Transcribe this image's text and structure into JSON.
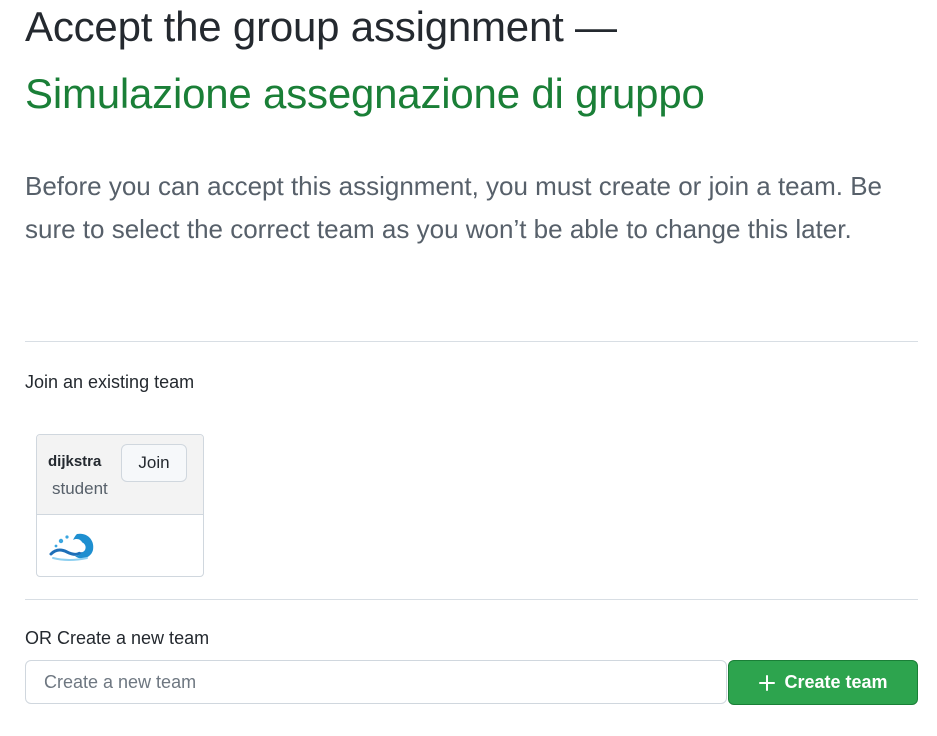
{
  "header": {
    "title_line1": "Accept the group assignment —",
    "title_line2": "Simulazione assegnazione di gruppo"
  },
  "intro": {
    "text": "Before you can accept this assignment, you must create or join a team. Be sure to select the correct team as you won’t be able to change this later."
  },
  "join_section": {
    "label": "Join an existing team",
    "teams": [
      {
        "name": "dijkstra",
        "role": "student",
        "join_label": "Join",
        "avatar_icon": "wave-avatar-icon"
      }
    ]
  },
  "create_section": {
    "label": "OR Create a new team",
    "input_placeholder": "Create a new team",
    "input_value": "",
    "button_label": "Create team",
    "button_icon": "plus-icon"
  },
  "colors": {
    "accent_green": "#1a7f37",
    "button_green": "#2da44e",
    "text": "#24292f",
    "muted_text": "#57606a",
    "border": "#d0d7de"
  }
}
